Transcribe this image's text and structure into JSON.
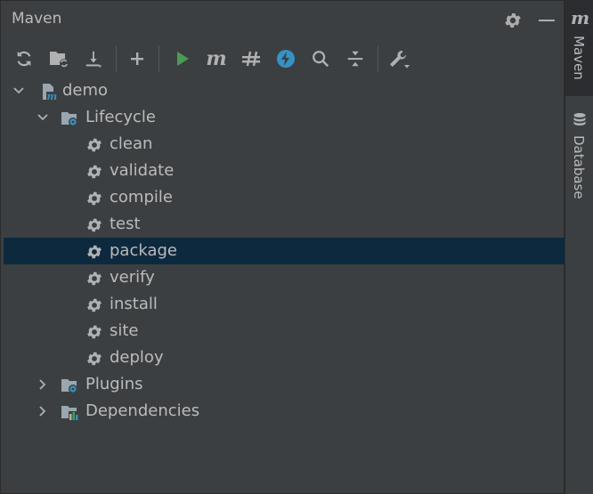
{
  "panel": {
    "title": "Maven"
  },
  "toolbar": {
    "buttons": [
      {
        "name": "reload-all-icon"
      },
      {
        "name": "generate-sources-icon"
      },
      {
        "name": "download-icon"
      },
      {
        "name": "add-icon"
      },
      {
        "name": "run-icon"
      },
      {
        "name": "execute-maven-goal-icon"
      },
      {
        "name": "toggle-offline-icon"
      },
      {
        "name": "skip-tests-icon"
      },
      {
        "name": "search-icon"
      },
      {
        "name": "collapse-all-icon"
      },
      {
        "name": "settings-wrench-icon"
      }
    ]
  },
  "tree": {
    "root": "demo",
    "lifecycle_label": "Lifecycle",
    "lifecycle_items": [
      "clean",
      "validate",
      "compile",
      "test",
      "package",
      "verify",
      "install",
      "site",
      "deploy"
    ],
    "selected": "package",
    "plugins_label": "Plugins",
    "dependencies_label": "Dependencies"
  },
  "sidebar": {
    "maven_tab": "Maven",
    "database_tab": "Database"
  },
  "colors": {
    "background": "#3c3f41",
    "selection": "#0d293e",
    "run_green": "#499c54",
    "accent_blue": "#3592c4"
  }
}
